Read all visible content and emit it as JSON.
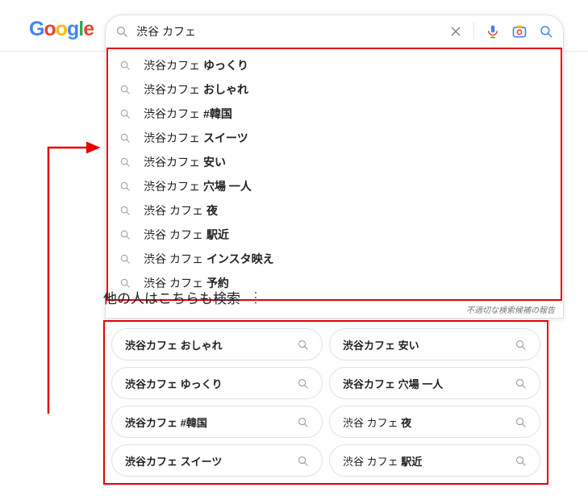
{
  "logo": {
    "g1": "G",
    "o1": "o",
    "o2": "o",
    "g2": "g",
    "l": "l",
    "e": "e"
  },
  "search": {
    "query": "渋谷 カフェ"
  },
  "suggestions": [
    {
      "prefix": "渋谷カフェ ",
      "bold": "ゆっくり"
    },
    {
      "prefix": "渋谷カフェ ",
      "bold": "おしゃれ"
    },
    {
      "prefix": "渋谷カフェ ",
      "bold": "#韓国"
    },
    {
      "prefix": "渋谷カフェ ",
      "bold": "スイーツ"
    },
    {
      "prefix": "渋谷カフェ ",
      "bold": "安い"
    },
    {
      "prefix": "渋谷カフェ ",
      "bold": "穴場 一人"
    },
    {
      "prefix": "渋谷 カフェ ",
      "bold": "夜"
    },
    {
      "prefix": "渋谷 カフェ ",
      "bold": "駅近"
    },
    {
      "prefix": "渋谷 カフェ ",
      "bold": "インスタ映え"
    },
    {
      "prefix": "渋谷 カフェ ",
      "bold": "予約"
    }
  ],
  "report_label": "不適切な検索候補の報告",
  "related": {
    "title": "他の人はこちらも検索",
    "items": [
      {
        "prefix": "渋谷カフェ ",
        "bold": "おしゃれ",
        "allbold": true
      },
      {
        "prefix": "渋谷カフェ ",
        "bold": "安い",
        "allbold": true
      },
      {
        "prefix": "渋谷カフェ ",
        "bold": "ゆっくり",
        "allbold": true
      },
      {
        "prefix": "渋谷カフェ ",
        "bold": "穴場 一人",
        "allbold": true
      },
      {
        "prefix": "渋谷カフェ ",
        "bold": "#韓国",
        "allbold": true
      },
      {
        "prefix": "渋谷 カフェ ",
        "bold": "夜",
        "allbold": false
      },
      {
        "prefix": "渋谷カフェ ",
        "bold": "スイーツ",
        "allbold": true
      },
      {
        "prefix": "渋谷 カフェ ",
        "bold": "駅近",
        "allbold": false
      }
    ]
  },
  "colors": {
    "annotation": "#e60000"
  }
}
